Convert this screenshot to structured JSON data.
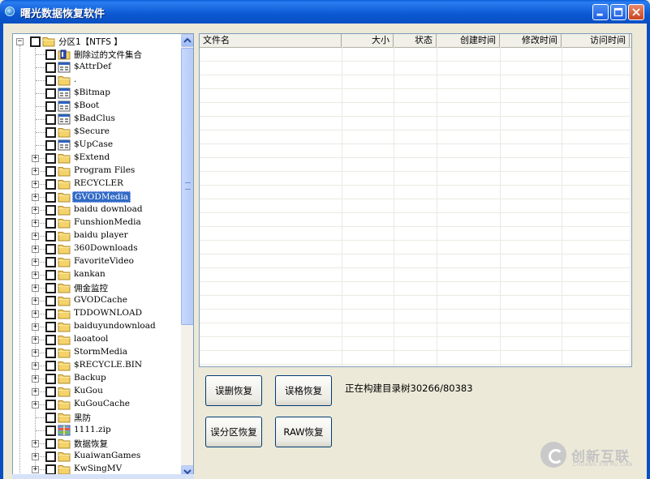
{
  "window": {
    "title": "曙光数据恢复软件"
  },
  "tree": {
    "root_label": "分区1【NTFS 】",
    "items": [
      {
        "label": "删除过的文件集合",
        "icon": "deleted-folder-icon",
        "expandable": false
      },
      {
        "label": "$AttrDef",
        "icon": "system-file-icon",
        "expandable": false
      },
      {
        "label": ".",
        "icon": "folder-icon",
        "expandable": false
      },
      {
        "label": "$Bitmap",
        "icon": "system-file-icon",
        "expandable": false
      },
      {
        "label": "$Boot",
        "icon": "system-file-icon",
        "expandable": false
      },
      {
        "label": "$BadClus",
        "icon": "system-file-icon",
        "expandable": false
      },
      {
        "label": "$Secure",
        "icon": "folder-icon",
        "expandable": false
      },
      {
        "label": "$UpCase",
        "icon": "system-file-icon",
        "expandable": false
      },
      {
        "label": "$Extend",
        "icon": "folder-icon",
        "expandable": true
      },
      {
        "label": "Program Files",
        "icon": "folder-icon",
        "expandable": true
      },
      {
        "label": "RECYCLER",
        "icon": "folder-icon",
        "expandable": true
      },
      {
        "label": "GVODMedia",
        "icon": "folder-icon",
        "expandable": true,
        "selected": true
      },
      {
        "label": "baidu download",
        "icon": "folder-icon",
        "expandable": true
      },
      {
        "label": "FunshionMedia",
        "icon": "folder-icon",
        "expandable": true
      },
      {
        "label": "baidu player",
        "icon": "folder-icon",
        "expandable": true
      },
      {
        "label": "360Downloads",
        "icon": "folder-icon",
        "expandable": true
      },
      {
        "label": "FavoriteVideo",
        "icon": "folder-icon",
        "expandable": true
      },
      {
        "label": "kankan",
        "icon": "folder-icon",
        "expandable": true
      },
      {
        "label": "佣金监控",
        "icon": "folder-icon",
        "expandable": true
      },
      {
        "label": "GVODCache",
        "icon": "folder-icon",
        "expandable": true
      },
      {
        "label": "TDDOWNLOAD",
        "icon": "folder-icon",
        "expandable": true
      },
      {
        "label": "baiduyundownload",
        "icon": "folder-icon",
        "expandable": true
      },
      {
        "label": "laoatool",
        "icon": "folder-icon",
        "expandable": true
      },
      {
        "label": "StormMedia",
        "icon": "folder-icon",
        "expandable": true
      },
      {
        "label": "$RECYCLE.BIN",
        "icon": "folder-icon",
        "expandable": true
      },
      {
        "label": "Backup",
        "icon": "folder-icon",
        "expandable": true
      },
      {
        "label": "KuGou",
        "icon": "folder-icon",
        "expandable": true
      },
      {
        "label": "KuGouCache",
        "icon": "folder-icon",
        "expandable": true
      },
      {
        "label": "黑防",
        "icon": "folder-icon",
        "expandable": false
      },
      {
        "label": "1111.zip",
        "icon": "zip-file-icon",
        "expandable": false
      },
      {
        "label": "数据恢复",
        "icon": "folder-icon",
        "expandable": true
      },
      {
        "label": "KuaiwanGames",
        "icon": "folder-icon",
        "expandable": true
      },
      {
        "label": "KwSingMV",
        "icon": "folder-icon",
        "expandable": true
      }
    ]
  },
  "file_list": {
    "columns": [
      "文件名",
      "大小",
      "状态",
      "创建时间",
      "修改时间",
      "访问时间"
    ],
    "rows": []
  },
  "buttons": {
    "undelete": "误删恢复",
    "unformat": "误格恢复",
    "partition_recover": "误分区恢复",
    "raw_recover": "RAW恢复"
  },
  "status_text": "正在构建目录树30266/80383",
  "watermark": {
    "text": "创新互联",
    "sub": "CHUANG XIN HU LIAN"
  },
  "colors": {
    "titlebar": "#0b58d2",
    "selection": "#316ac5",
    "folder": "#f5d36b",
    "window_bg": "#ece9d8"
  }
}
